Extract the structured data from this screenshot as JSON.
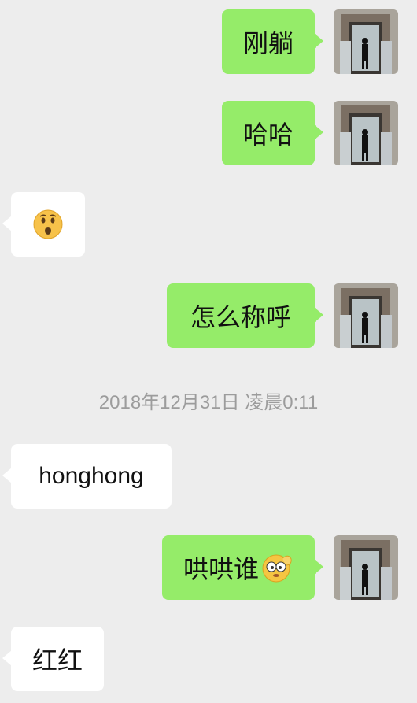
{
  "messages": [
    {
      "side": "out",
      "text": "刚躺"
    },
    {
      "side": "out",
      "text": "哈哈"
    },
    {
      "side": "in",
      "emoji": "hushed-face-emoji"
    },
    {
      "side": "out",
      "text": "怎么称呼"
    },
    {
      "side": "in",
      "text": "honghong"
    },
    {
      "side": "out",
      "text": "哄哄谁",
      "emoji": "flushed-peek-sticker"
    },
    {
      "side": "in",
      "text": "红红"
    }
  ],
  "timestamp": "2018年12月31日 凌晨0:11",
  "colors": {
    "outgoing_bubble": "#95ec69",
    "incoming_bubble": "#ffffff",
    "background": "#ededed",
    "timestamp_text": "#9c9c9c"
  }
}
